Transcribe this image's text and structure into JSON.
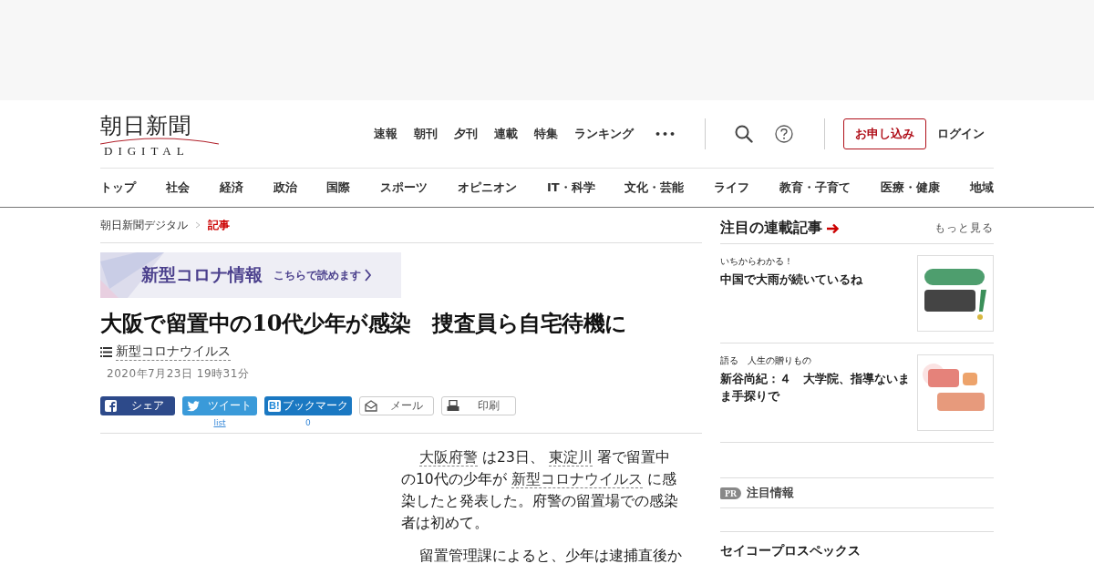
{
  "logo": {
    "main": "朝日新聞",
    "sub": "DIGITAL"
  },
  "top_nav": [
    "速報",
    "朝刊",
    "夕刊",
    "連載",
    "特集",
    "ランキング"
  ],
  "more_menu": "•••",
  "subscribe_button": "お申し込み",
  "login": "ログイン",
  "categories": [
    "トップ",
    "社会",
    "経済",
    "政治",
    "国際",
    "スポーツ",
    "オピニオン",
    "IT・科学",
    "文化・芸能",
    "ライフ",
    "教育・子育て",
    "医療・健康",
    "地域"
  ],
  "breadcrumbs": [
    {
      "label": "朝日新聞デジタル",
      "current": false
    },
    {
      "label": "記事",
      "current": true
    }
  ],
  "banner": {
    "title": "新型コロナ情報",
    "link": "こちらで読めます"
  },
  "article": {
    "title": "大阪で留置中の10代少年が感染　捜査員ら自宅待機に",
    "topic": "新型コロナウイルス",
    "date": "2020年7月23日 19時31分",
    "share": [
      {
        "kind": "facebook",
        "label": "シェア"
      },
      {
        "kind": "twitter",
        "label": "ツイート",
        "count": "list"
      },
      {
        "kind": "hatena",
        "icon": "B!",
        "label": "ブックマーク",
        "count": "0"
      },
      {
        "kind": "mail",
        "label": "メール"
      },
      {
        "kind": "print",
        "label": "印刷"
      }
    ],
    "paragraphs": [
      [
        {
          "kind": "link",
          "text": "大阪府警"
        },
        {
          "kind": "text",
          "text": " は23日、 "
        },
        {
          "kind": "link",
          "text": "東淀川"
        },
        {
          "kind": "text",
          "text": " 署で留置中の10代の少年が "
        },
        {
          "kind": "link",
          "text": "新型コロナウイルス"
        },
        {
          "kind": "text",
          "text": " に感染したと発表した。府警の留置場での感染者は初めて。"
        }
      ],
      [
        {
          "kind": "text",
          "text": "留置管理課によると、少年は逮捕直後か"
        }
      ]
    ]
  },
  "sidebar": {
    "heading": "注目の連載記事",
    "more": "もっと見る",
    "items": [
      {
        "series": "いちからわかる！",
        "title": "中国で大雨が続いているね",
        "kind": "picture"
      },
      {
        "series": "語る　人生の贈りもの",
        "title": "新谷尚紀：４　大学院、指導ないまま手探りで",
        "kind": "picture"
      }
    ],
    "pr": {
      "badge": "PR",
      "label": "注目情報"
    },
    "ad_title": "セイコープロスペックス"
  }
}
